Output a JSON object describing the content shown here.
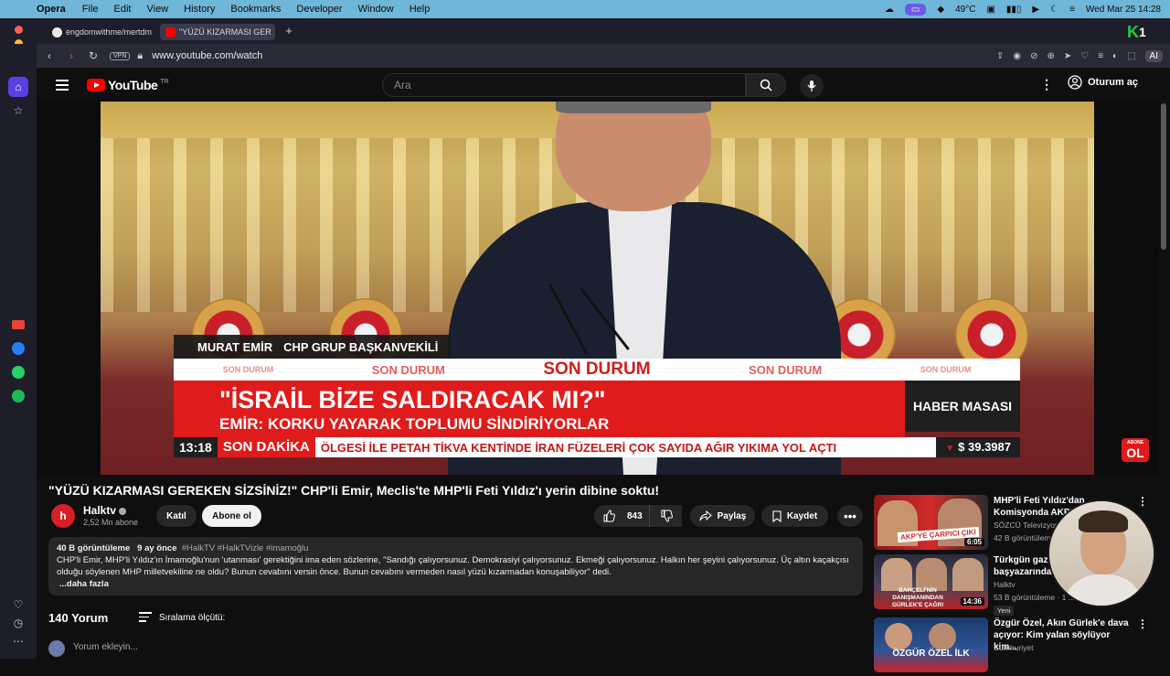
{
  "macos_menubar": {
    "app_name": "Opera",
    "menus": [
      "File",
      "Edit",
      "View",
      "History",
      "Bookmarks",
      "Developer",
      "Window",
      "Help"
    ],
    "temperature": "49°C",
    "datetime": "Wed Mar 25  14:28"
  },
  "browser": {
    "tabs": [
      {
        "label": "engdomwithme/mertdm"
      },
      {
        "label": "\"YÜZÜ KIZARMASI GER"
      }
    ],
    "new_tab": "+",
    "vpn_label": "VPN",
    "url": "www.youtube.com/watch",
    "ai_label": "AI"
  },
  "yt_header": {
    "logo_text": "YouTube",
    "logo_suffix": "TR",
    "search_placeholder": "Ara",
    "sign_in": "Oturum aç"
  },
  "video_overlay": {
    "name": "MURAT EMİR",
    "role": "CHP GRUP BAŞKANVEKİLİ",
    "strip": [
      "SON DURUM",
      "SON DURUM",
      "SON DURUM",
      "SON DURUM",
      "SON DURUM"
    ],
    "headline": "\"İSRAİL BİZE SALDIRACAK MI?\"",
    "subheadline": "EMİR: KORKU YAYARAK TOPLUMU SİNDİRİYORLAR",
    "desk": "HABER MASASI",
    "time": "13:18",
    "flash": "SON DAKİKA",
    "ticker": "ÖLGESİ İLE PETAH TİKVA KENTİNDE İRAN FÜZELERİ ÇOK SAYIDA AĞIR YIKIMA YOL AÇTI",
    "fx": "$ 39.3987",
    "abone_small": "ABONE",
    "abone_big": "OL"
  },
  "video": {
    "title": "\"YÜZÜ KIZARMASI GEREKEN SİZSİNİZ!\" CHP'li Emir, Meclis'te MHP'li Feti Yıldız'ı yerin dibine soktu!",
    "channel": "Halktv",
    "subscribers": "2,52 Mn abone",
    "join": "Katıl",
    "subscribe": "Abone ol",
    "likes": "843",
    "share": "Paylaş",
    "save": "Kaydet"
  },
  "description": {
    "views": "40 B görüntüleme",
    "age": "9 ay önce",
    "tags": "#HalkTV #HalkTVizle #imamoğlu",
    "text": "CHP'li Emir, MHP'li Yıldız'ın İmamoğlu'nun 'utanması' gerektiğini ima eden sözlerine, \"Sandığı çalıyorsunuz. Demokrasiyi çalıyorsunuz. Ekmeği çalıyorsunuz. Halkın her şeyini çalıyorsunuz. Üç altın kaçakçısı olduğu söylenen MHP milletvekiline ne oldu? Bunun cevabını versin önce. Bunun cevabını vermeden nasıl yüzü kızarmadan konuşabiliyor\" dedi.",
    "more": "...daha fazla"
  },
  "comments": {
    "count": "140 Yorum",
    "sort": "Sıralama ölçütü:",
    "placeholder": "Yorum ekleyin..."
  },
  "recommendations": [
    {
      "title": "MHP'li Feti Yıldız'dan Komisyonda AKP'ye S...",
      "channel": "SÖZCÜ Televizyonu",
      "meta": "42 B görüntüleme",
      "duration": "6:05",
      "thumb_caption": "AKP'YE ÇARPICI ÇIKI",
      "thumb_colors": [
        "#8c1a1a",
        "#d12a2a",
        "#2b2b2b"
      ]
    },
    {
      "title": "Türkgün gaze... başyazarından...",
      "channel": "Halktv",
      "meta": "53 B görüntüleme · 1 ...",
      "duration": "14:36",
      "badge": "Yeni",
      "thumb_caption": "BAHÇELİ'NİN DANIŞMANINDAN GÜRLEK'E ÇAĞRI",
      "thumb_colors": [
        "#2a2a3a",
        "#b52424",
        "#f2f2f2"
      ]
    },
    {
      "title": "Özgür Özel, Akın Gürlek'e dava açıyor: Kim yalan söylüyor kim...",
      "channel": "Cumhuriyet",
      "meta": "",
      "duration": "",
      "thumb_caption": "ÖZGÜR ÖZEL İLK",
      "thumb_colors": [
        "#1c3a6e",
        "#c92323",
        "#eeeeee"
      ]
    }
  ],
  "colors": {
    "yt_red": "#ff0000",
    "breaking_red": "#e01b1b",
    "yt_bg": "#0f0f0f",
    "menubar": "#6fb6d8",
    "opera_accent": "#6b5ce8"
  }
}
